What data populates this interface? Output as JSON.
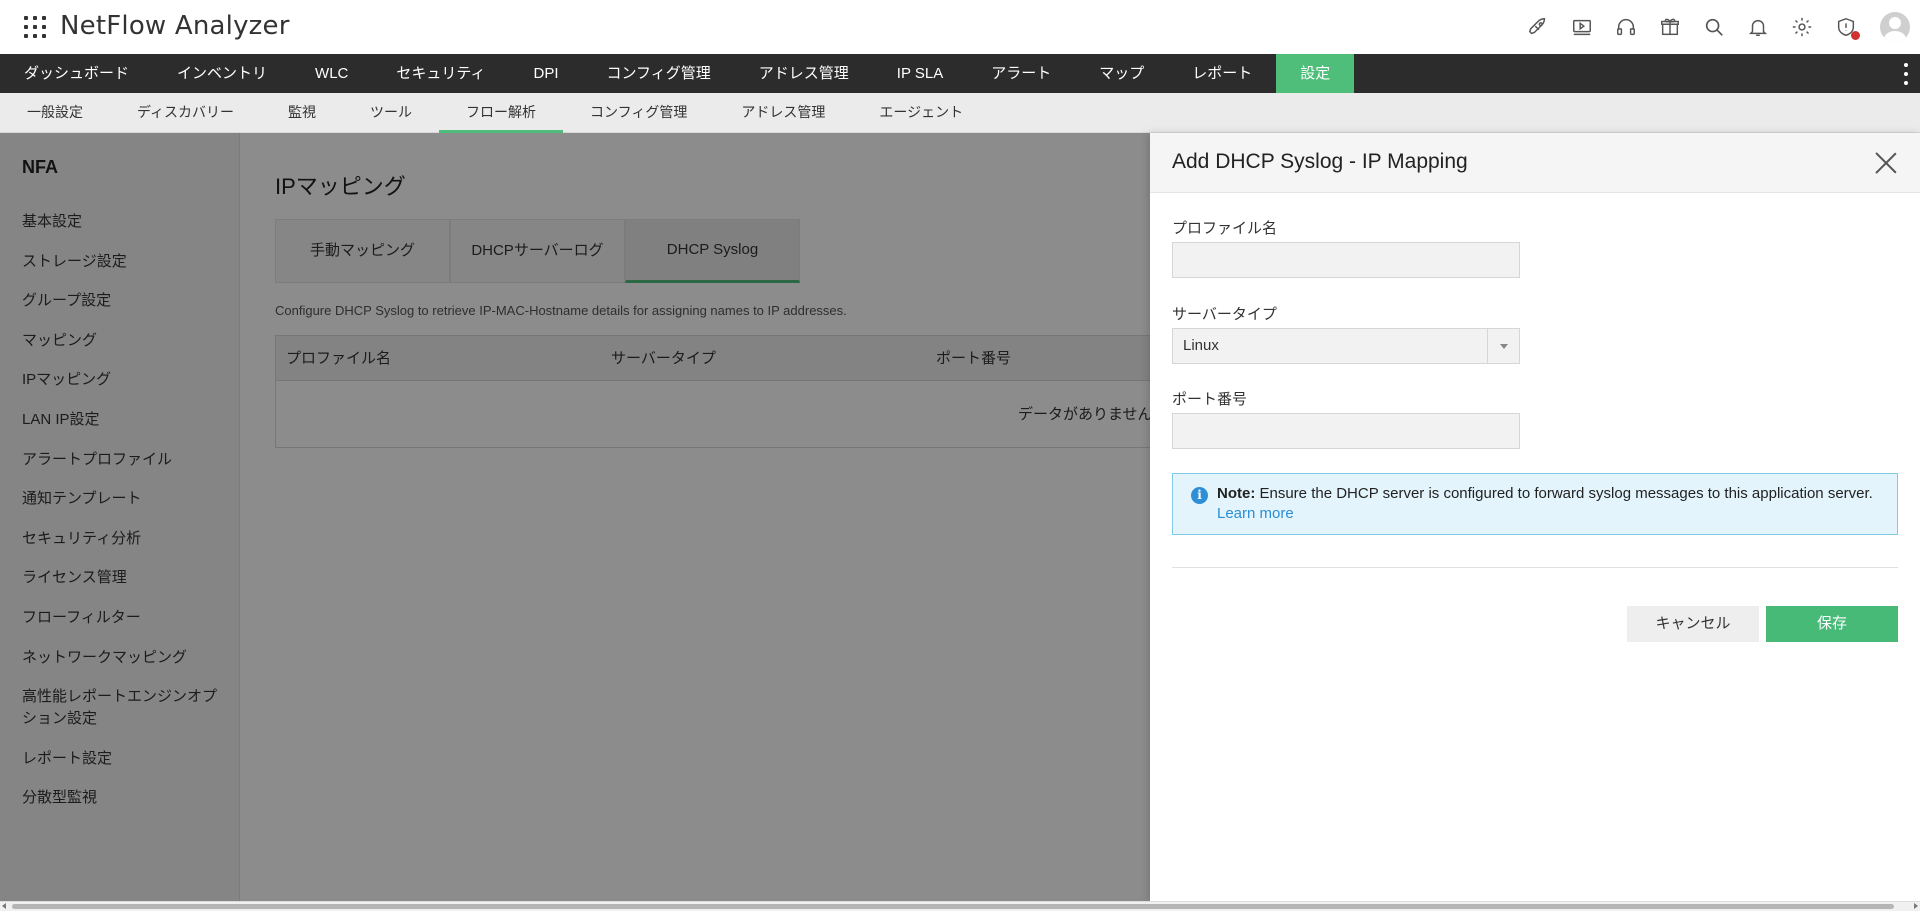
{
  "app": {
    "title": "NetFlow Analyzer"
  },
  "header_icons": [
    "rocket-icon",
    "video-icon",
    "headset-icon",
    "gift-icon",
    "search-icon",
    "bell-icon",
    "gear-icon",
    "shield-alert-icon"
  ],
  "colors": {
    "accent": "#4fbe7a",
    "nav_bg": "#2c2c2c",
    "link": "#2a8fd4",
    "note_bg": "#e3f4fc",
    "alert": "#d0302f"
  },
  "main_nav": [
    {
      "label": "ダッシュボード"
    },
    {
      "label": "インベントリ"
    },
    {
      "label": "WLC"
    },
    {
      "label": "セキュリティ"
    },
    {
      "label": "DPI"
    },
    {
      "label": "コンフィグ管理"
    },
    {
      "label": "アドレス管理"
    },
    {
      "label": "IP SLA"
    },
    {
      "label": "アラート"
    },
    {
      "label": "マップ"
    },
    {
      "label": "レポート"
    },
    {
      "label": "設定",
      "active": true
    }
  ],
  "sub_nav": [
    {
      "label": "一般設定"
    },
    {
      "label": "ディスカバリー"
    },
    {
      "label": "監視"
    },
    {
      "label": "ツール"
    },
    {
      "label": "フロー解析",
      "active": true
    },
    {
      "label": "コンフィグ管理"
    },
    {
      "label": "アドレス管理"
    },
    {
      "label": "エージェント"
    }
  ],
  "sidebar": {
    "title": "NFA",
    "items": [
      "基本設定",
      "ストレージ設定",
      "グループ設定",
      "マッピング",
      "IPマッピング",
      "LAN IP設定",
      "アラートプロファイル",
      "通知テンプレート",
      "セキュリティ分析",
      "ライセンス管理",
      "フローフィルター",
      "ネットワークマッピング",
      "高性能レポートエンジンオプション設定",
      "レポート設定",
      "分散型監視"
    ]
  },
  "content": {
    "title": "IPマッピング",
    "tabs": [
      {
        "label": "手動マッピング"
      },
      {
        "label": "DHCPサーバーログ"
      },
      {
        "label": "DHCP Syslog",
        "active": true
      }
    ],
    "description": "Configure DHCP Syslog to retrieve IP-MAC-Hostname details for assigning names to IP addresses.",
    "table": {
      "columns": [
        "プロファイル名",
        "サーバータイプ",
        "ポート番号"
      ],
      "empty_text": "データがありません"
    }
  },
  "dialog": {
    "title": "Add DHCP Syslog - IP Mapping",
    "fields": {
      "profile_name": {
        "label": "プロファイル名",
        "value": ""
      },
      "server_type": {
        "label": "サーバータイプ",
        "value": "Linux"
      },
      "port": {
        "label": "ポート番号",
        "value": ""
      }
    },
    "note": {
      "prefix": "Note:",
      "text": " Ensure the DHCP server is configured to forward syslog messages to this application server.",
      "link": "Learn more"
    },
    "buttons": {
      "cancel": "キャンセル",
      "save": "保存"
    }
  }
}
